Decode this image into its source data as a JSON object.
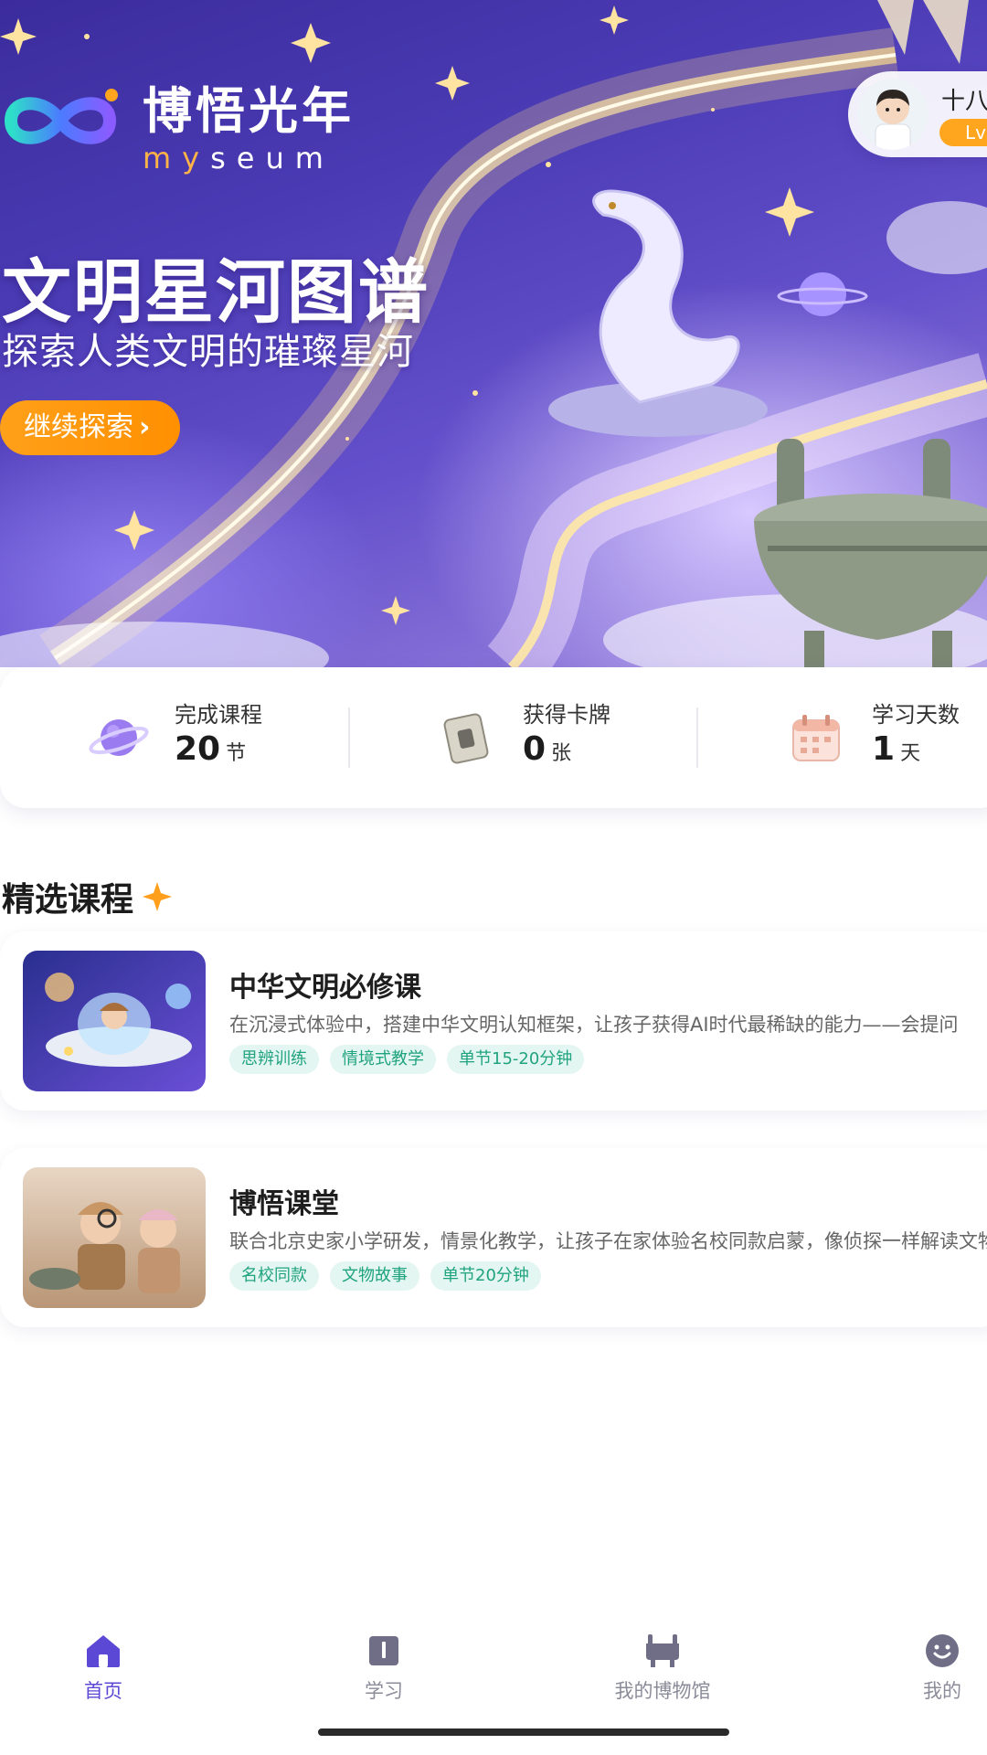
{
  "app": {
    "logo_cn": "博悟光年",
    "logo_en": "myseum"
  },
  "profile": {
    "name": "十八",
    "level_label": "Lv"
  },
  "hero": {
    "title": "文明星河图谱",
    "subtitle": "探索人类文明的璀璨星河",
    "cta_label": "继续探索"
  },
  "stats": [
    {
      "label": "完成课程",
      "value": "20",
      "unit": "节",
      "icon": "planet-icon"
    },
    {
      "label": "获得卡牌",
      "value": "0",
      "unit": "张",
      "icon": "card-icon"
    },
    {
      "label": "学习天数",
      "value": "1",
      "unit": "天",
      "icon": "calendar-icon"
    }
  ],
  "section": {
    "title": "精选课程"
  },
  "courses": [
    {
      "title": "中华文明必修课",
      "desc": "在沉浸式体验中，搭建中华文明认知框架，让孩子获得AI时代最稀缺的能力——会提问",
      "tags": [
        "思辨训练",
        "情境式教学",
        "单节15-20分钟"
      ]
    },
    {
      "title": "博悟课堂",
      "desc": "联合北京史家小学研发，情景化教学，让孩子在家体验名校同款启蒙，像侦探一样解读文物",
      "tags": [
        "名校同款",
        "文物故事",
        "单节20分钟"
      ]
    }
  ],
  "nav": [
    {
      "label": "首页",
      "icon": "home-icon",
      "active": true
    },
    {
      "label": "学习",
      "icon": "book-icon",
      "active": false
    },
    {
      "label": "我的博物馆",
      "icon": "museum-icon",
      "active": false
    },
    {
      "label": "我的",
      "icon": "smile-icon",
      "active": false
    }
  ],
  "colors": {
    "accent": "#5b49d6",
    "cta": "#ff9a18",
    "tag_text": "#20a37f",
    "tag_bg": "#e4f6f1"
  }
}
